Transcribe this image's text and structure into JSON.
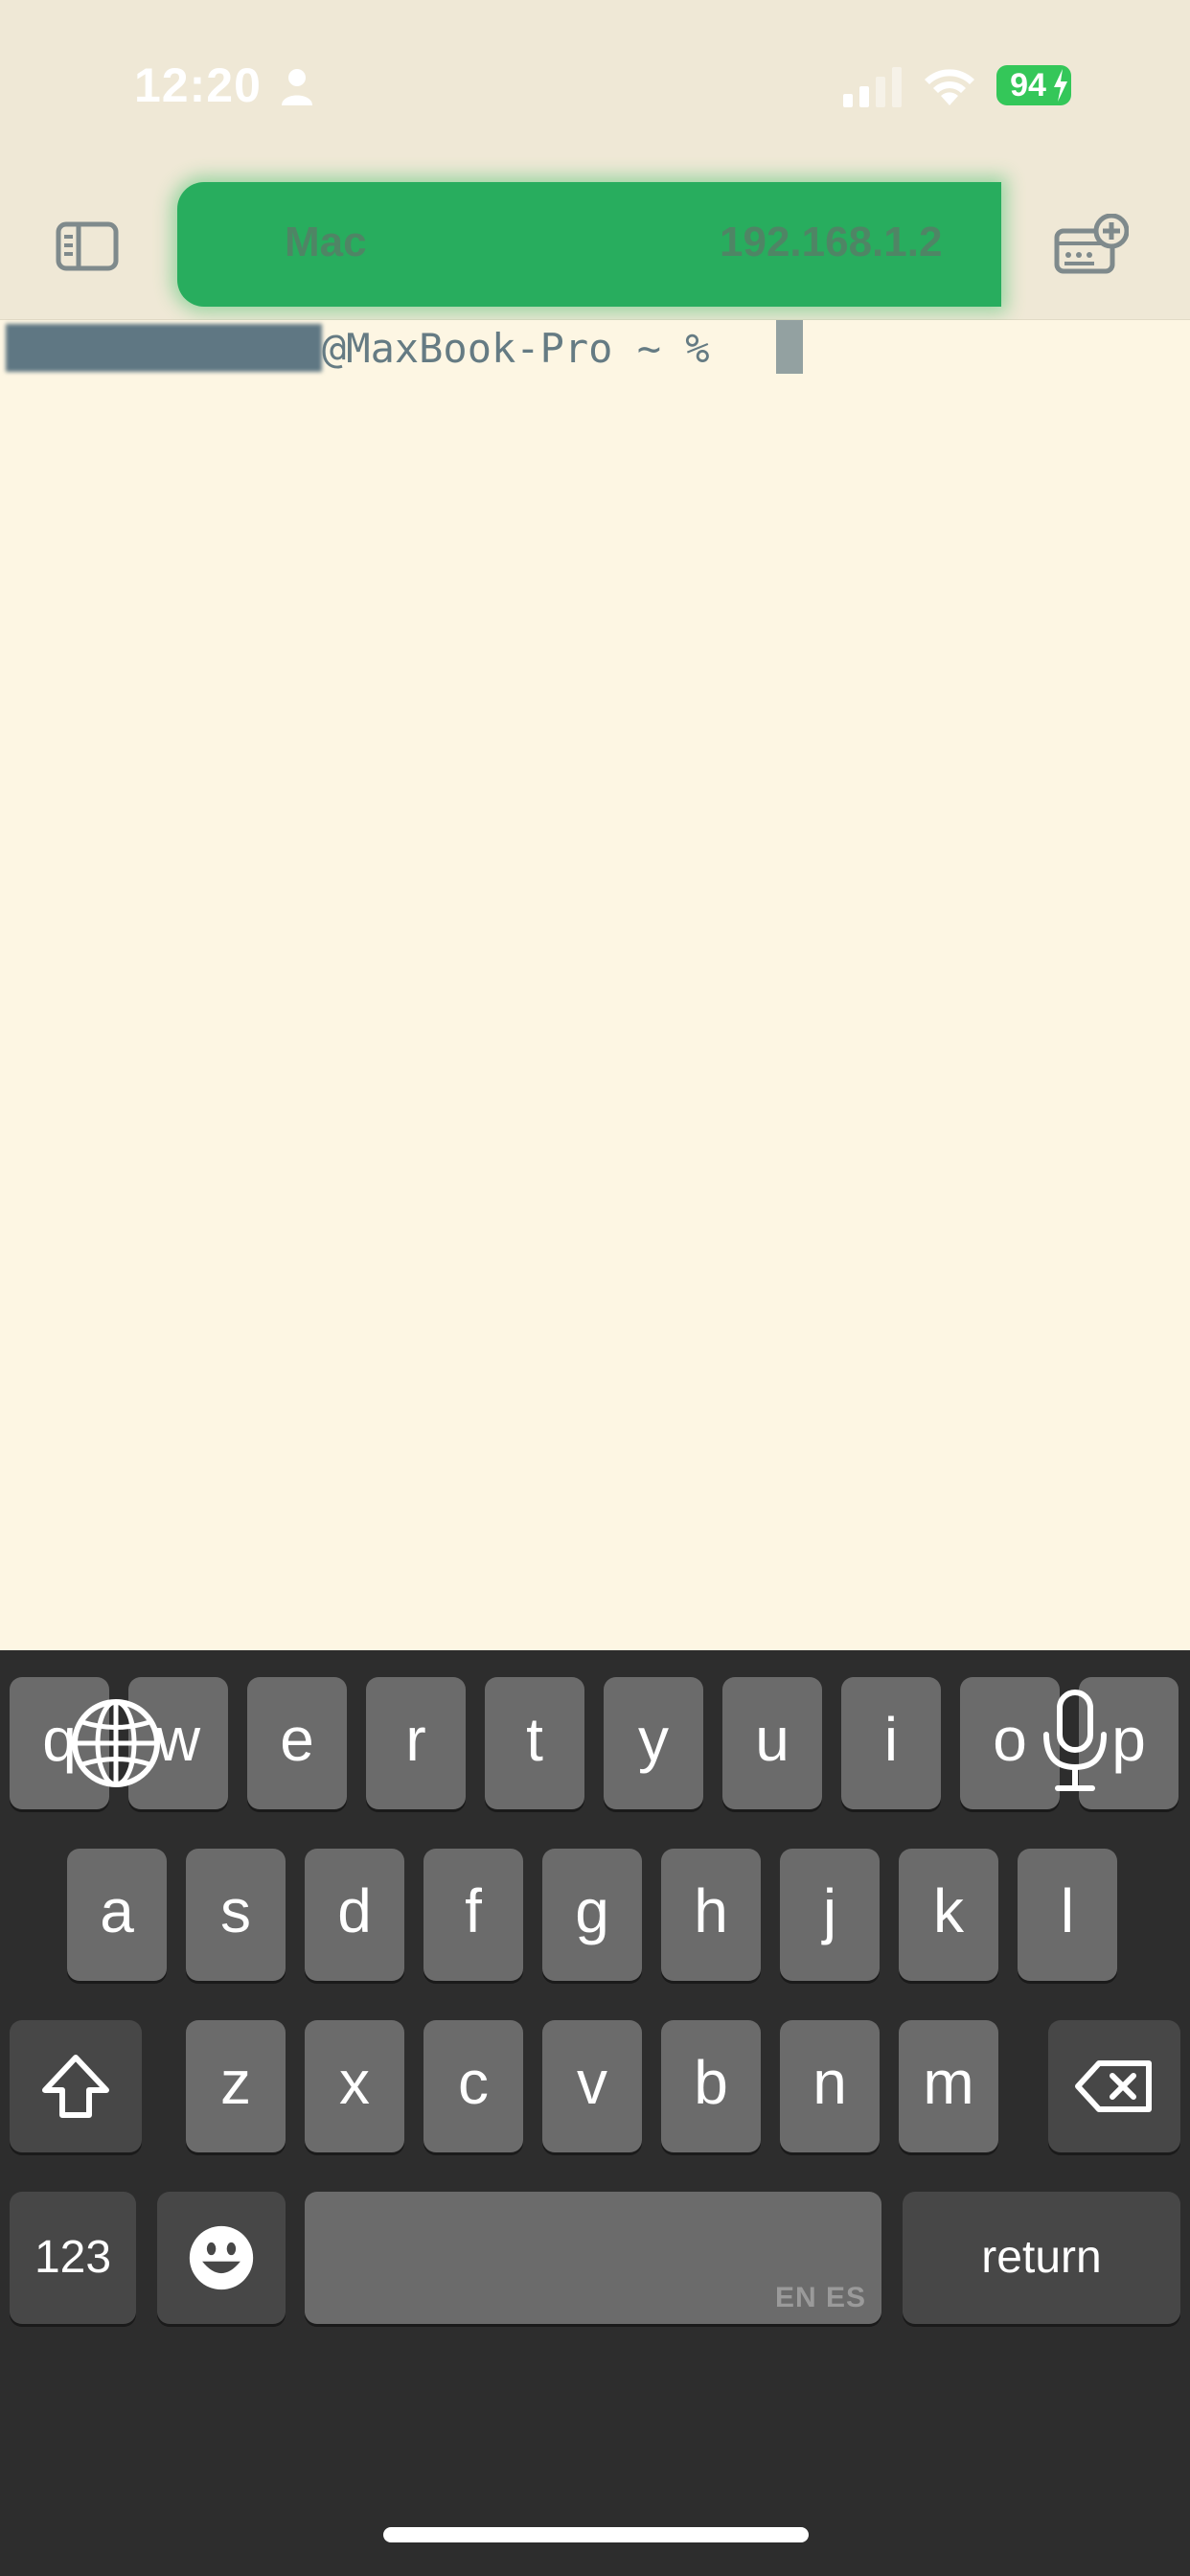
{
  "status_bar": {
    "time": "12:20",
    "battery_level": "94"
  },
  "toolbar": {
    "session_name": "Mac",
    "session_host": "192.168.1.2",
    "accent_color": "#28ad5e"
  },
  "terminal": {
    "prompt_suffix": "@MaxBook-Pro ~ % "
  },
  "keyboard": {
    "row1": [
      "q",
      "w",
      "e",
      "r",
      "t",
      "y",
      "u",
      "i",
      "o",
      "p"
    ],
    "row2": [
      "a",
      "s",
      "d",
      "f",
      "g",
      "h",
      "j",
      "k",
      "l"
    ],
    "row3": [
      "z",
      "x",
      "c",
      "v",
      "b",
      "n",
      "m"
    ],
    "numbers_label": "123",
    "return_label": "return",
    "language_label": "EN ES"
  }
}
